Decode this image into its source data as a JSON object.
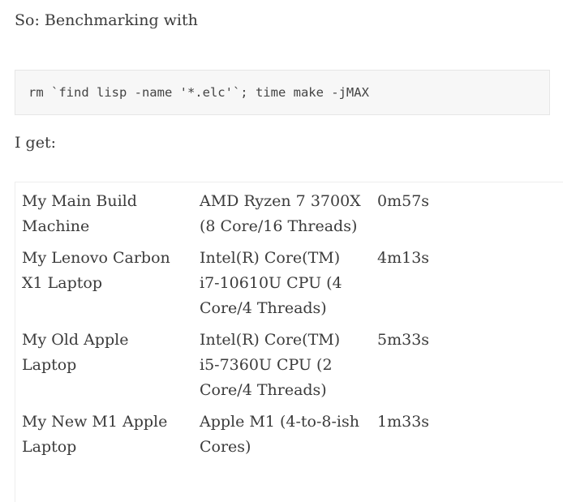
{
  "article": {
    "intro": "So: Benchmarking with",
    "code": "rm `find lisp -name '*.elc'`; time make -jMAX",
    "result_label": "I get:"
  },
  "benchmarks": [
    {
      "machine": "My Main Build Machine",
      "cpu": "AMD Ryzen 7 3700X (8 Core/16 Threads)",
      "time": "0m57s"
    },
    {
      "machine": "My Lenovo Carbon X1 Laptop",
      "cpu": "Intel(R) Core(TM) i7-10610U CPU (4 Core/4 Threads)",
      "time": "4m13s"
    },
    {
      "machine": "My Old Apple Laptop",
      "cpu": "Intel(R) Core(TM) i5-7360U CPU (2 Core/4 Threads)",
      "time": "5m33s"
    },
    {
      "machine": "My New M1 Apple Laptop",
      "cpu": "Apple M1 (4-to-8-ish Cores)",
      "time": "1m33s"
    }
  ]
}
